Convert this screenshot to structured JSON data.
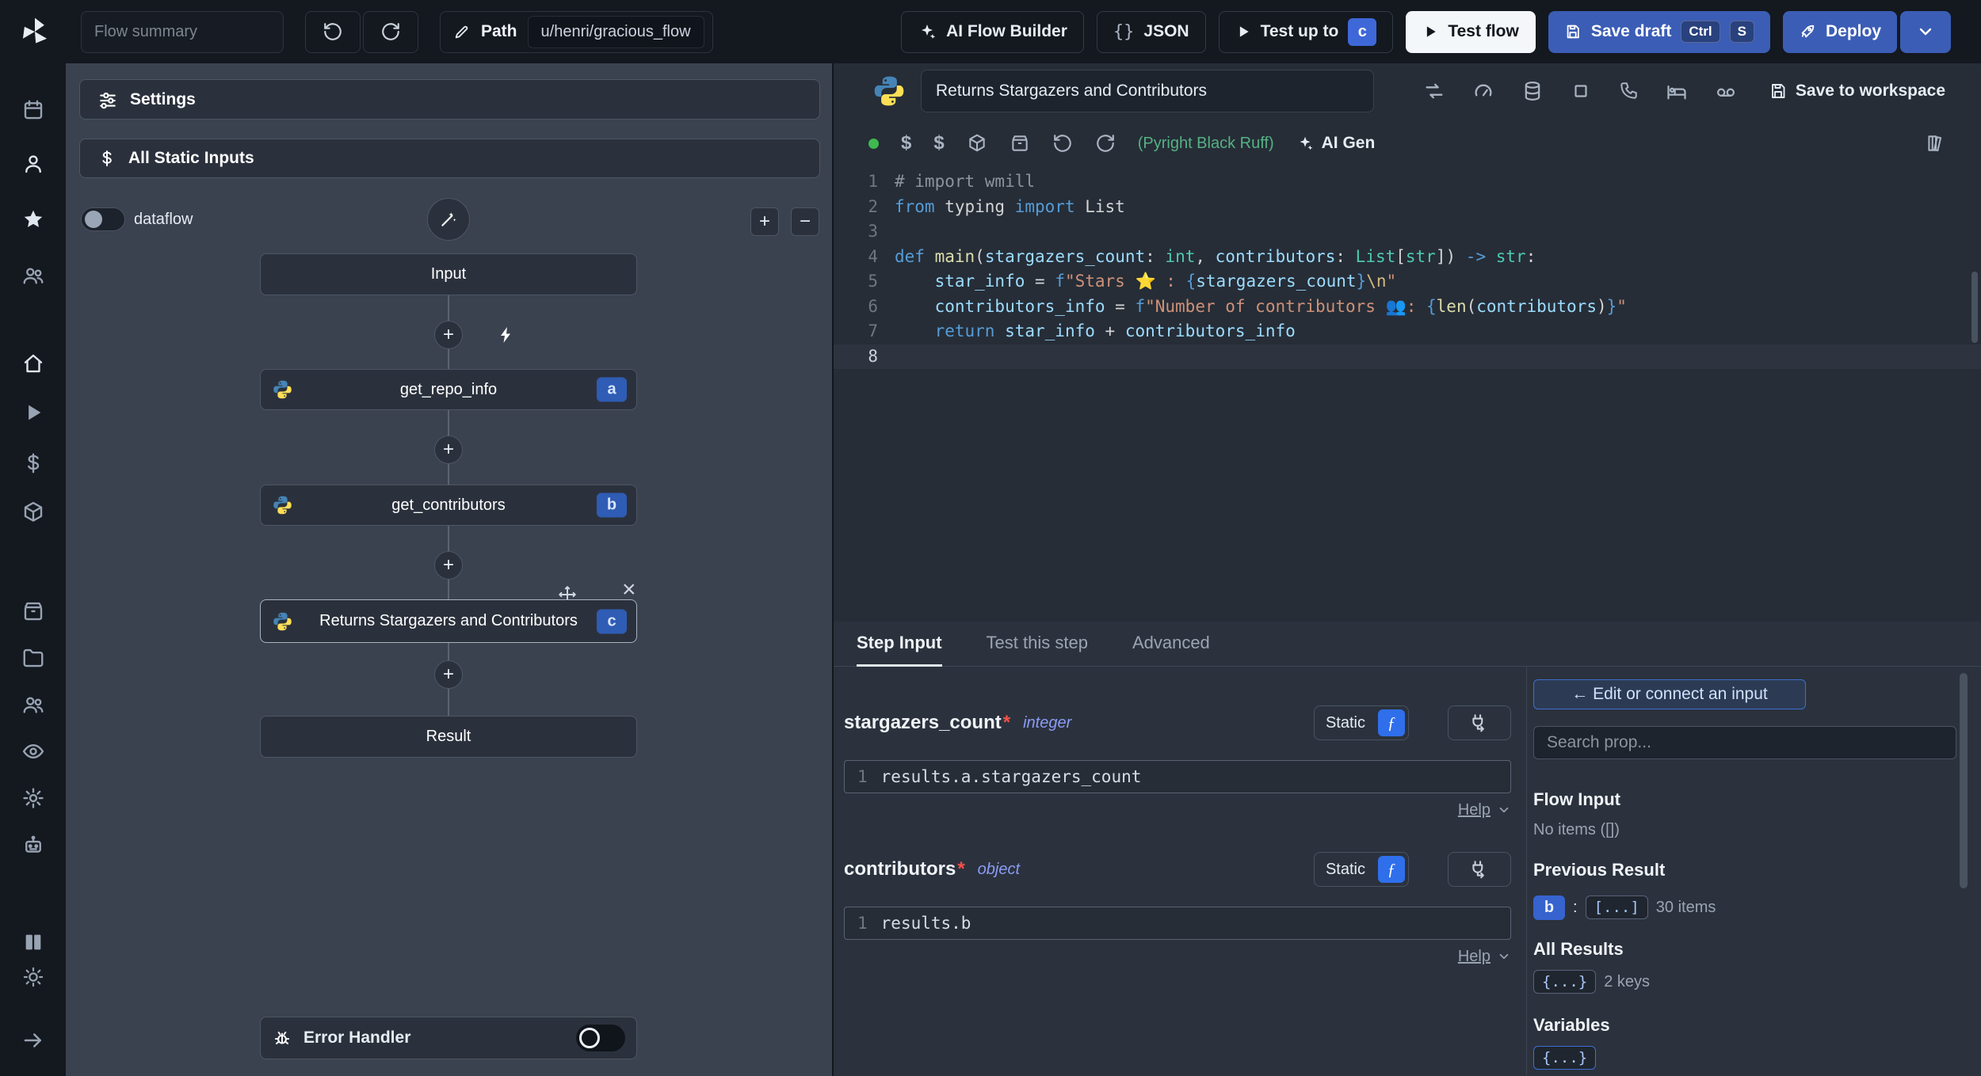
{
  "colors": {
    "accent_blue": "#3b82f6",
    "button_blue": "#3b5db5",
    "badge_blue": "#2f5cb4",
    "success_green": "#3fb950",
    "panel_bg": "#3a4250",
    "editor_bg": "#262d37"
  },
  "topbar": {
    "flow_summary_placeholder": "Flow summary",
    "path_label": "Path",
    "path_value": "u/henri/gracious_flow",
    "ai_flow_builder_label": "AI Flow Builder",
    "json_label": "JSON",
    "json_icon_glyph": "{}",
    "test_up_to_label": "Test up to",
    "test_up_to_badge": "c",
    "test_flow_label": "Test flow",
    "save_draft_label": "Save draft",
    "save_draft_kbd1": "Ctrl",
    "save_draft_kbd2": "S",
    "deploy_label": "Deploy"
  },
  "flow_panel": {
    "settings_label": "Settings",
    "static_inputs_label": "All Static Inputs",
    "dataflow_label": "dataflow",
    "zoom_in_glyph": "+",
    "zoom_out_glyph": "−",
    "input_node": "Input",
    "steps": [
      {
        "label": "get_repo_info",
        "badge": "a"
      },
      {
        "label": "get_contributors",
        "badge": "b"
      },
      {
        "label": "Returns Stargazers and Contributors",
        "badge": "c"
      }
    ],
    "close_glyph": "×",
    "plus_glyph": "+",
    "result_node": "Result",
    "error_handler_label": "Error Handler"
  },
  "editor": {
    "title": "Returns Stargazers and Contributors",
    "save_to_workspace_label": "Save to workspace",
    "assistants_label": "(Pyright Black Ruff)",
    "ai_gen_label": "AI Gen",
    "code": {
      "active_line": 8,
      "lines": [
        [
          {
            "t": "# import wmill",
            "c": "com"
          }
        ],
        [
          {
            "t": "from",
            "c": "kw"
          },
          {
            "t": " typing ",
            "c": "pl"
          },
          {
            "t": "import",
            "c": "kw"
          },
          {
            "t": " List",
            "c": "pl"
          }
        ],
        [],
        [
          {
            "t": "def",
            "c": "kw"
          },
          {
            "t": " ",
            "c": "pl"
          },
          {
            "t": "main",
            "c": "fn"
          },
          {
            "t": "(",
            "c": "pl"
          },
          {
            "t": "stargazers_count",
            "c": "var"
          },
          {
            "t": ": ",
            "c": "pl"
          },
          {
            "t": "int",
            "c": "type"
          },
          {
            "t": ", ",
            "c": "pl"
          },
          {
            "t": "contributors",
            "c": "var"
          },
          {
            "t": ": ",
            "c": "pl"
          },
          {
            "t": "List",
            "c": "type"
          },
          {
            "t": "[",
            "c": "pl"
          },
          {
            "t": "str",
            "c": "type"
          },
          {
            "t": "]",
            "c": "pl"
          },
          {
            "t": ") ",
            "c": "pl"
          },
          {
            "t": "->",
            "c": "kw"
          },
          {
            "t": " ",
            "c": "pl"
          },
          {
            "t": "str",
            "c": "type"
          },
          {
            "t": ":",
            "c": "pl"
          }
        ],
        [
          {
            "t": "    ",
            "c": "pl"
          },
          {
            "t": "star_info",
            "c": "var"
          },
          {
            "t": " = ",
            "c": "pl"
          },
          {
            "t": "f",
            "c": "kw"
          },
          {
            "t": "\"Stars ",
            "c": "str"
          },
          {
            "t": "⭐",
            "c": "emoji"
          },
          {
            "t": " : ",
            "c": "str"
          },
          {
            "t": "{",
            "c": "brace"
          },
          {
            "t": "stargazers_count",
            "c": "var"
          },
          {
            "t": "}",
            "c": "brace"
          },
          {
            "t": "\\n",
            "c": "esc"
          },
          {
            "t": "\"",
            "c": "str"
          }
        ],
        [
          {
            "t": "    ",
            "c": "pl"
          },
          {
            "t": "contributors_info",
            "c": "var"
          },
          {
            "t": " = ",
            "c": "pl"
          },
          {
            "t": "f",
            "c": "kw"
          },
          {
            "t": "\"Number of contributors ",
            "c": "str"
          },
          {
            "t": "👥",
            "c": "emoji"
          },
          {
            "t": ": ",
            "c": "str"
          },
          {
            "t": "{",
            "c": "brace"
          },
          {
            "t": "len",
            "c": "fn"
          },
          {
            "t": "(",
            "c": "pl"
          },
          {
            "t": "contributors",
            "c": "var"
          },
          {
            "t": ")",
            "c": "pl"
          },
          {
            "t": "}",
            "c": "brace"
          },
          {
            "t": "\"",
            "c": "str"
          }
        ],
        [
          {
            "t": "    ",
            "c": "pl"
          },
          {
            "t": "return",
            "c": "kw"
          },
          {
            "t": " ",
            "c": "pl"
          },
          {
            "t": "star_info",
            "c": "var"
          },
          {
            "t": " + ",
            "c": "pl"
          },
          {
            "t": "contributors_info",
            "c": "var"
          }
        ],
        []
      ]
    }
  },
  "step_panel": {
    "tabs": {
      "step_input": "Step Input",
      "test_this_step": "Test this step",
      "advanced": "Advanced"
    },
    "fields": [
      {
        "name": "stargazers_count",
        "required": "*",
        "type": "integer",
        "mode": "Static",
        "fx": "ƒ",
        "line": "1",
        "expr": "results.a.stargazers_count",
        "help": "Help"
      },
      {
        "name": "contributors",
        "required": "*",
        "type": "object",
        "mode": "Static",
        "fx": "ƒ",
        "line": "1",
        "expr": "results.b",
        "help": "Help"
      }
    ]
  },
  "connect_panel": {
    "edit_button_label": "← Edit or connect an input",
    "search_placeholder": "Search prop...",
    "flow_input_title": "Flow Input",
    "flow_input_empty": "No items ([])",
    "previous_result_title": "Previous Result",
    "previous_result_badge": "b",
    "previous_result_colon": ":",
    "previous_result_chip": "[...]",
    "previous_result_count": "30 items",
    "all_results_title": "All Results",
    "all_results_chip": "{...}",
    "all_results_count": "2 keys",
    "variables_title": "Variables",
    "variables_chip": "{...}"
  }
}
